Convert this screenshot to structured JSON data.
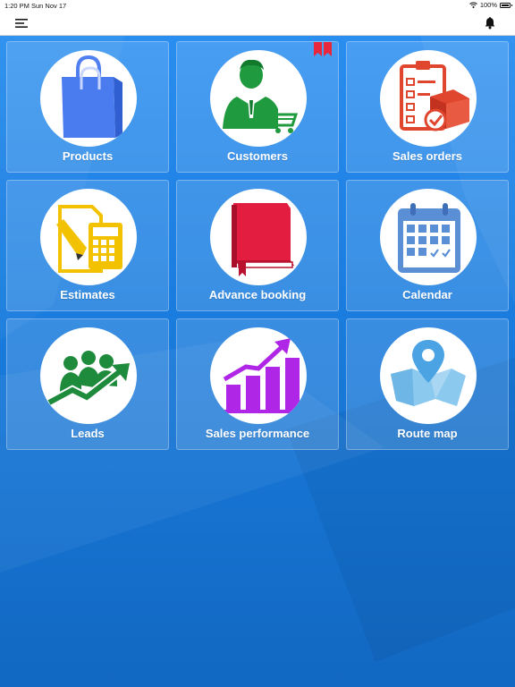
{
  "status_bar": {
    "time": "1:20 PM",
    "date": "Sun Nov 17",
    "battery": "100%"
  },
  "nav": {
    "menu_icon": "hamburger-menu-icon",
    "bell_icon": "bell-icon"
  },
  "colors": {
    "background": "#1677d6",
    "tile": "rgba(255,255,255,0.14)",
    "badge": "#e8263c"
  },
  "tiles": [
    {
      "label": "Products",
      "icon": "shopping-bag-icon"
    },
    {
      "label": "Customers",
      "icon": "customer-cart-icon",
      "badge": "bookmark-badge-icon"
    },
    {
      "label": "Sales orders",
      "icon": "clipboard-box-icon"
    },
    {
      "label": "Estimates",
      "icon": "calculator-document-icon"
    },
    {
      "label": "Advance booking",
      "icon": "book-icon"
    },
    {
      "label": "Calendar",
      "icon": "calendar-icon"
    },
    {
      "label": "Leads",
      "icon": "people-growth-icon"
    },
    {
      "label": "Sales performance",
      "icon": "bar-chart-growth-icon"
    },
    {
      "label": "Route map",
      "icon": "map-pin-icon"
    }
  ]
}
